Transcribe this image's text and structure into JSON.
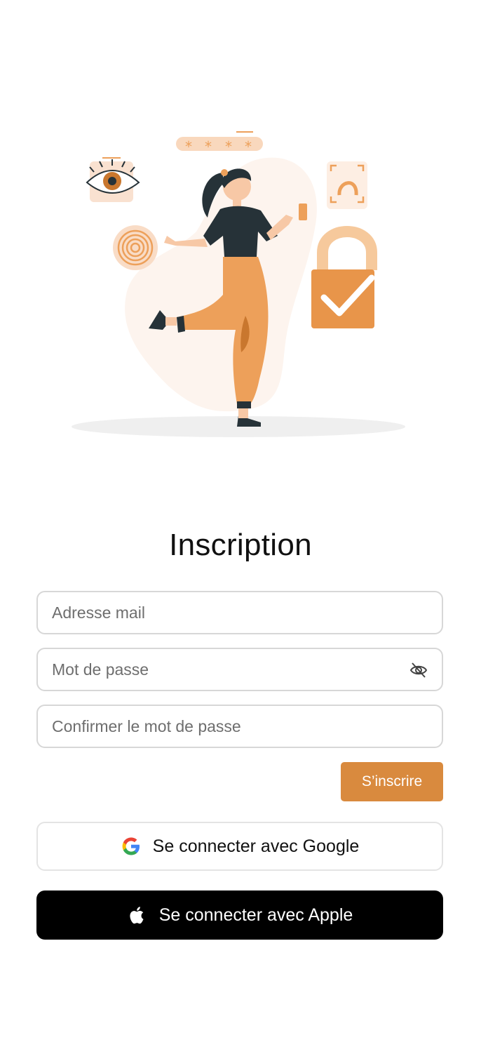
{
  "form": {
    "title": "Inscription",
    "email_placeholder": "Adresse mail",
    "password_placeholder": "Mot de passe",
    "confirm_placeholder": "Confirmer le mot de passe",
    "submit_label": "S’inscrire"
  },
  "social": {
    "google_label": "Se connecter avec Google",
    "apple_label": "Se connecter avec Apple"
  },
  "colors": {
    "accent": "#d98a3e",
    "illustration_orange": "#eda05a",
    "apple_bg": "#000000"
  },
  "icons": {
    "password_toggle": "eye-off-icon",
    "google": "google-icon",
    "apple": "apple-icon"
  }
}
